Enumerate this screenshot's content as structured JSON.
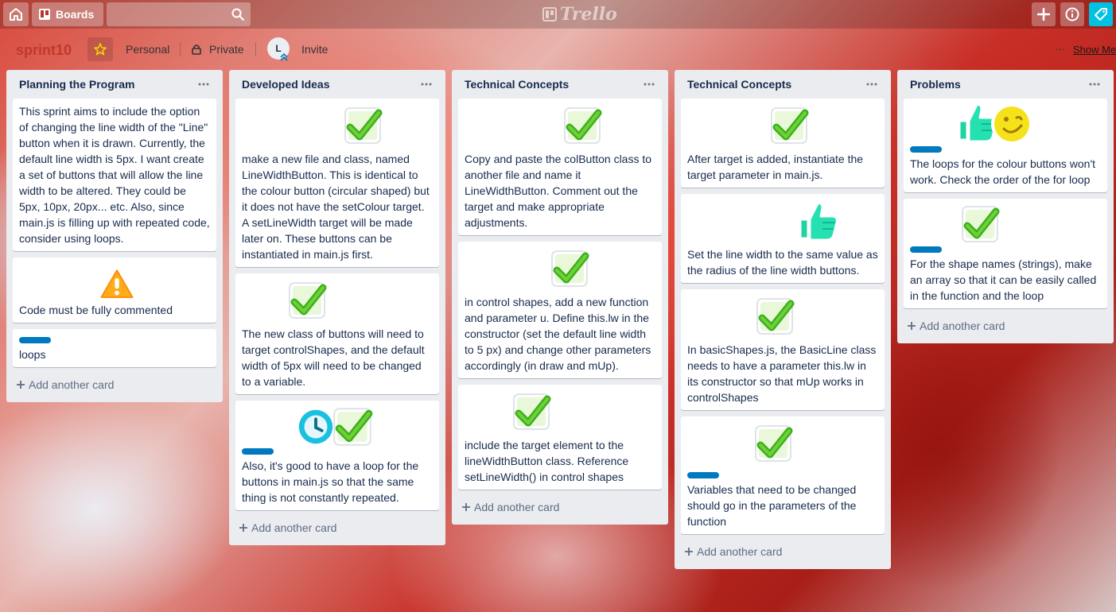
{
  "header": {
    "boards_label": "Boards",
    "search": {
      "value": "",
      "placeholder": ""
    },
    "logo_text": "Trello",
    "colors": {
      "accent_notif": "#00c2e0"
    }
  },
  "board": {
    "title": "sprint10",
    "team": "Personal",
    "visibility": "Private",
    "member_initial": "L",
    "invite_label": "Invite",
    "menu_dots": "···",
    "show_menu_label": "Show Menu"
  },
  "add_card_label": "Add another card",
  "icons": {
    "check": "check-sticker-icon",
    "warning": "warning-sticker-icon",
    "clock": "clock-sticker-icon",
    "thumbs_up": "thumbs-up-sticker-icon",
    "smile": "smile-sticker-icon"
  },
  "label_color": "#0079bf",
  "lists": [
    {
      "title": "Planning the Program",
      "cards": [
        {
          "text": "This sprint aims to include the option of changing the line width of the \"Line\" button when it is drawn. Currently, the default line width is 5px. I want create a set of buttons that will allow the line width to be altered. They could be 5px, 10px, 20px... etc. Also, since main.js is filling up with repeated code, consider using loops."
        },
        {
          "text": "Code must be fully commented",
          "sticker": "warning"
        },
        {
          "text": "loops",
          "label": true
        }
      ]
    },
    {
      "title": "Developed Ideas",
      "cards": [
        {
          "text": "make a new file and class, named LineWidthButton. This is identical to the colour button (circular shaped) but it does not have the setColour target. A setLineWidth target will be made later on. These buttons can be instantiated in main.js first.",
          "sticker": "check"
        },
        {
          "text": "The new class of buttons will need to target controlShapes, and the default width of 5px will need to be changed to a variable.",
          "sticker": "check"
        },
        {
          "text": "Also, it's good to have a loop for the buttons in main.js so that the same thing is not constantly repeated.",
          "sticker": "clock+check",
          "label": true
        }
      ]
    },
    {
      "title": "Technical Concepts",
      "cards": [
        {
          "text": "Copy and paste the colButton class to another file and name it LineWidthButton. Comment out the target and make appropriate adjustments.",
          "sticker": "check"
        },
        {
          "text": "in control shapes, add a new function and parameter u. Define this.lw in the constructor (set the default line width to 5 px) and change other parameters accordingly (in draw and mUp).",
          "sticker": "check"
        },
        {
          "text": "include the target element to the lineWidthButton class. Reference setLineWidth() in control shapes",
          "sticker": "check"
        }
      ]
    },
    {
      "title": "Technical Concepts",
      "cards": [
        {
          "text": "After target is added, instantiate the target parameter in main.js.",
          "sticker": "check"
        },
        {
          "text": "Set the line width to the same value as the radius of the line width buttons.",
          "sticker": "thumbs"
        },
        {
          "text": "In basicShapes.js, the BasicLine class needs to have a parameter this.lw in its constructor so that mUp works in controlShapes",
          "sticker": "check"
        },
        {
          "text": "Variables that need to be changed should go in the parameters of the function",
          "sticker": "check",
          "label": true
        }
      ]
    },
    {
      "title": "Problems",
      "cards": [
        {
          "text": "The loops for the colour buttons won't work. Check the order of the for loop",
          "sticker": "thumbs+smile",
          "label": true
        },
        {
          "text": "For the shape names (strings), make an array so that it can be easily called in the function and the loop",
          "sticker": "check",
          "label": true
        }
      ]
    }
  ]
}
